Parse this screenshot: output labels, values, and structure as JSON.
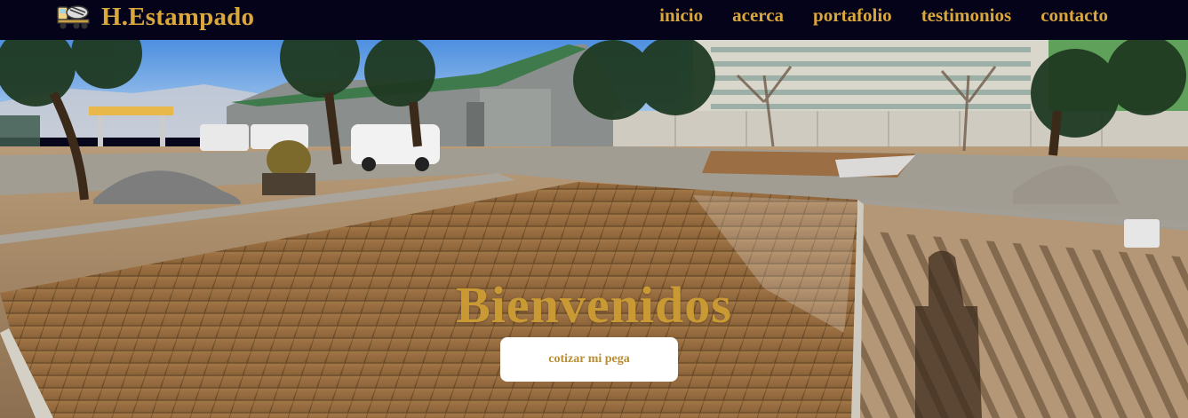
{
  "brand": {
    "name": "H.Estampado",
    "logo_icon": "concrete-mixer-truck-icon"
  },
  "nav": {
    "items": [
      {
        "label": "inicio"
      },
      {
        "label": "acerca"
      },
      {
        "label": "portafolio"
      },
      {
        "label": "testimonios"
      },
      {
        "label": "contacto"
      }
    ]
  },
  "hero": {
    "title": "Bienvenidos",
    "cta_label": "cotizar mi pega",
    "background": "stamped-concrete-patio-photo"
  },
  "colors": {
    "navbar_bg": "#05031a",
    "accent_gold": "#d9a73b",
    "title_gold": "#c99a34",
    "button_bg": "#ffffff",
    "button_text": "#b88d33"
  }
}
